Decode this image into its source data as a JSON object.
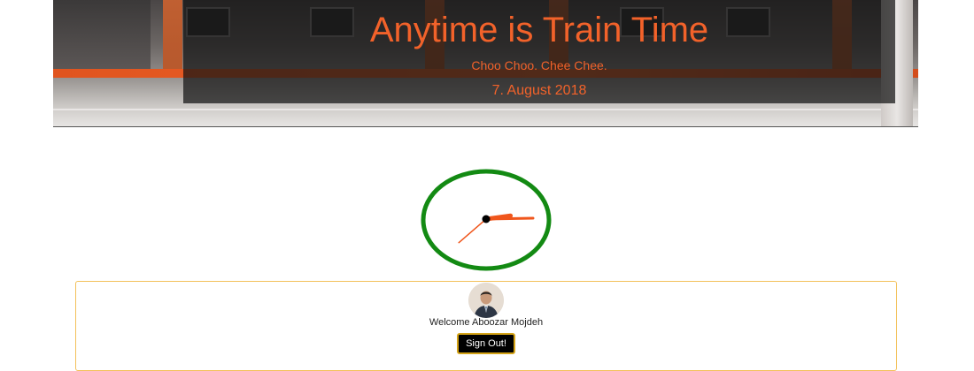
{
  "header": {
    "title": "Anytime is Train Time",
    "tagline": "Choo Choo. Chee Chee.",
    "date": "7. August 2018"
  },
  "clock": {
    "hour": 2,
    "minute": 20,
    "second": 37,
    "ring_color": "#138a13",
    "hand_color": "#f0561c"
  },
  "user": {
    "welcome_text": "Welcome Aboozar Mojdeh",
    "sign_out_label": "Sign Out!"
  },
  "colors": {
    "accent": "#f2622a",
    "card_border": "#f3c15a",
    "button_border": "#d4a317"
  }
}
